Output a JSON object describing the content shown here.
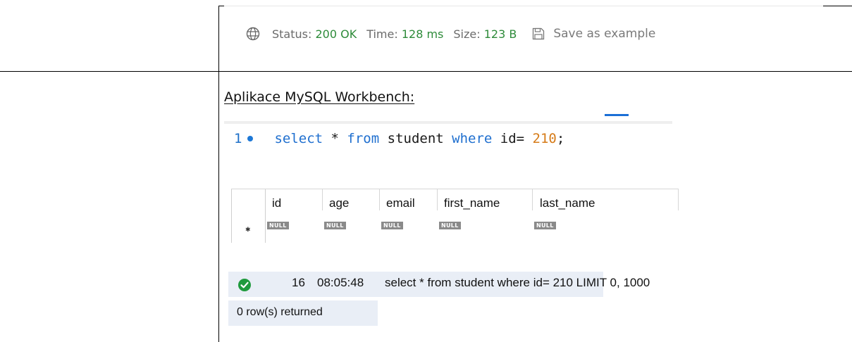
{
  "status_bar": {
    "globe_icon": "globe-icon",
    "status_label": "Status:",
    "status_value": "200 OK",
    "time_label": "Time:",
    "time_value": "128 ms",
    "size_label": "Size:",
    "size_value": "123 B",
    "save_icon": "save-icon",
    "save_label": "Save as example",
    "ok_color": "#2e8b3a"
  },
  "section": {
    "heading": "Aplikace MySQL Workbench:"
  },
  "editor": {
    "line_number": "1",
    "kw_select": "select",
    "star": " * ",
    "kw_from": "from",
    "table_name": " student ",
    "kw_where": "where",
    "condition": " id= ",
    "value": "210",
    "terminator": ";",
    "keyword_color": "#1f6fcf",
    "number_color": "#d67b18"
  },
  "result_grid": {
    "columns": [
      "id",
      "age",
      "email",
      "first_name",
      "last_name"
    ],
    "row": [
      "NULL",
      "NULL",
      "NULL",
      "NULL",
      "NULL"
    ]
  },
  "output": {
    "status_icon": "check-circle-icon",
    "number": "16",
    "time": "08:05:48",
    "action": "select * from student where id= 210 LIMIT 0, 1000",
    "message": "0 row(s) returned"
  }
}
